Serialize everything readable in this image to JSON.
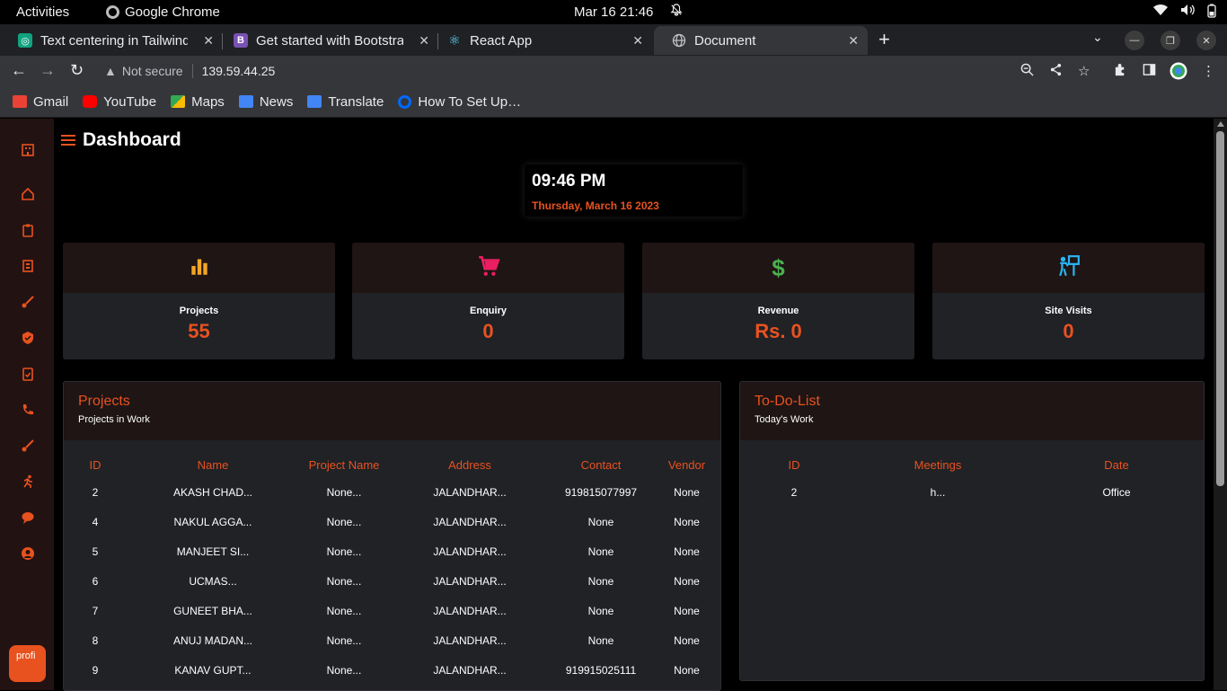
{
  "os": {
    "activities": "Activities",
    "app_name": "Google Chrome",
    "datetime": "Mar 16  21:46"
  },
  "browser": {
    "tabs": [
      {
        "title": "Text centering in Tailwind",
        "favicon": "chatgpt-icon",
        "color": "#10a37f"
      },
      {
        "title": "Get started with Bootstrap",
        "favicon": "bootstrap-icon",
        "color": "#7952b3"
      },
      {
        "title": "React App",
        "favicon": "react-icon",
        "color": "#61dafb"
      },
      {
        "title": "Document",
        "favicon": "globe-icon",
        "color": "#9aa0a6",
        "active": true
      }
    ],
    "security_label": "Not secure",
    "url": "139.59.44.25",
    "bookmarks": [
      {
        "label": "Gmail",
        "icon": "gmail-icon",
        "color": "#ea4335"
      },
      {
        "label": "YouTube",
        "icon": "youtube-icon",
        "color": "#ff0000"
      },
      {
        "label": "Maps",
        "icon": "maps-icon",
        "color": "#34a853"
      },
      {
        "label": "News",
        "icon": "news-icon",
        "color": "#4285f4"
      },
      {
        "label": "Translate",
        "icon": "translate-icon",
        "color": "#4285f4"
      },
      {
        "label": "How To Set Up…",
        "icon": "digitalocean-icon",
        "color": "#0069ff"
      }
    ]
  },
  "app": {
    "title": "Dashboard",
    "clock": {
      "time": "09:46 PM",
      "date": "Thursday, March 16 2023"
    },
    "accent": "#e8521f",
    "sidebar_avatar_alt": "profi",
    "stats": [
      {
        "label": "Projects",
        "value": "55",
        "icon": "bar-chart-icon",
        "color": "#f5a623"
      },
      {
        "label": "Enquiry",
        "value": "0",
        "icon": "cart-icon",
        "color": "#e91e63"
      },
      {
        "label": "Revenue",
        "value": "Rs. 0",
        "icon": "dollar-icon",
        "color": "#4caf50"
      },
      {
        "label": "Site Visits",
        "value": "0",
        "icon": "site-visit-icon",
        "color": "#29b6f6"
      }
    ],
    "projects": {
      "title": "Projects",
      "subtitle": "Projects in Work",
      "columns": [
        "ID",
        "Name",
        "Project Name",
        "Address",
        "Contact",
        "Vendor"
      ],
      "rows": [
        [
          "2",
          "AKASH CHAD...",
          "None...",
          "JALANDHAR...",
          "919815077997",
          "None"
        ],
        [
          "4",
          "NAKUL AGGA...",
          "None...",
          "JALANDHAR...",
          "None",
          "None"
        ],
        [
          "5",
          "MANJEET SI...",
          "None...",
          "JALANDHAR...",
          "None",
          "None"
        ],
        [
          "6",
          "UCMAS...",
          "None...",
          "JALANDHAR...",
          "None",
          "None"
        ],
        [
          "7",
          "GUNEET BHA...",
          "None...",
          "JALANDHAR...",
          "None",
          "None"
        ],
        [
          "8",
          "ANUJ MADAN...",
          "None...",
          "JALANDHAR...",
          "None",
          "None"
        ],
        [
          "9",
          "KANAV GUPT...",
          "None...",
          "JALANDHAR...",
          "919915025111",
          "None"
        ]
      ]
    },
    "todo": {
      "title": "To-Do-List",
      "subtitle": "Today's Work",
      "columns": [
        "ID",
        "Meetings",
        "Date"
      ],
      "rows": [
        [
          "2",
          "h...",
          "Office"
        ]
      ]
    }
  }
}
